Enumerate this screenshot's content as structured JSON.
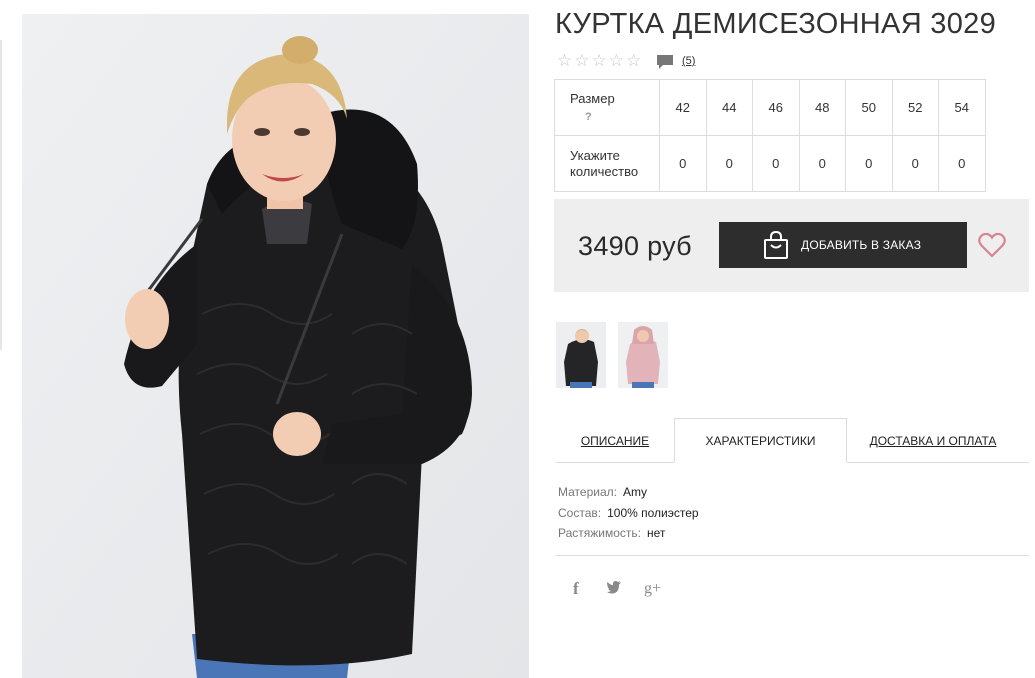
{
  "product": {
    "title": "КУРТКА ДЕМИСЕЗОННАЯ 3029",
    "review_count": "(5)",
    "rating_stars": 0,
    "rating_max": 5
  },
  "sizes_table": {
    "size_label": "Размер",
    "size_help": "?",
    "qty_label_line1": "Укажите",
    "qty_label_line2": "количество",
    "sizes": [
      "42",
      "44",
      "46",
      "48",
      "50",
      "52",
      "54"
    ],
    "quantities": [
      "0",
      "0",
      "0",
      "0",
      "0",
      "0",
      "0"
    ]
  },
  "purchase": {
    "price": "3490 руб",
    "order_button_label": "ДОБАВИТЬ В ЗАКАЗ",
    "heart_color": "#d9838e"
  },
  "tabs": {
    "description": "ОПИСАНИЕ",
    "characteristics": "ХАРАКТЕРИСТИКИ",
    "delivery": "ДОСТАВКА И ОПЛАТА",
    "active": "characteristics"
  },
  "specs": [
    {
      "key": "Материал:",
      "value": "Amy"
    },
    {
      "key": "Состав:",
      "value": "100% полиэстер"
    },
    {
      "key": "Растяжимость:",
      "value": "нет"
    }
  ],
  "social": {
    "facebook": "f",
    "twitter": "twitter-icon",
    "googleplus": "g+"
  },
  "colors": {
    "button_bg": "#2d2d2d",
    "price_box_bg": "#eeeeee",
    "border": "#dcdcdc",
    "jacket": "#1c1c1e"
  }
}
